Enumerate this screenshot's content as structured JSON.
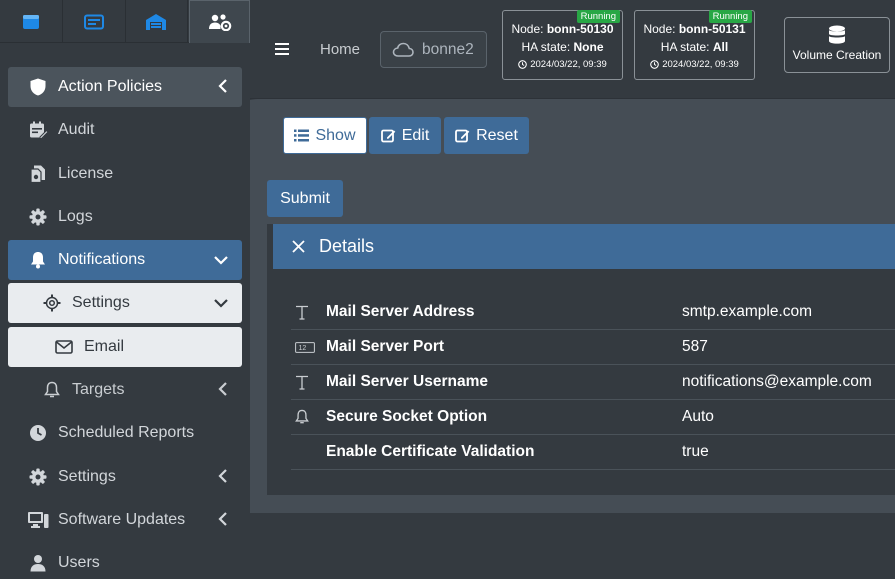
{
  "header": {
    "home_label": "Home",
    "cluster_name": "bonne2",
    "nodes": [
      {
        "node_prefix": "Node:",
        "name": "bonn-50130",
        "status": "Running",
        "ha_prefix": "HA state:",
        "ha_state": "None",
        "time": "2024/03/22, 09:39"
      },
      {
        "node_prefix": "Node:",
        "name": "bonn-50131",
        "status": "Running",
        "ha_prefix": "HA state:",
        "ha_state": "All",
        "time": "2024/03/22, 09:39"
      }
    ],
    "volume_creation_label": "Volume Creation"
  },
  "sidebar": {
    "items": [
      {
        "label": "Action Policies",
        "icon": "shield-icon"
      },
      {
        "label": "Audit",
        "icon": "calendar-edit-icon"
      },
      {
        "label": "License",
        "icon": "file-icon"
      },
      {
        "label": "Logs",
        "icon": "gear-icon"
      },
      {
        "label": "Notifications",
        "icon": "bell-icon"
      },
      {
        "label": "Settings",
        "icon": "gear-outline-icon"
      },
      {
        "label": "Email",
        "icon": "envelope-icon"
      },
      {
        "label": "Targets",
        "icon": "bell-outline-icon"
      },
      {
        "label": "Scheduled Reports",
        "icon": "clock-icon"
      },
      {
        "label": "Settings",
        "icon": "gear-icon"
      },
      {
        "label": "Software Updates",
        "icon": "desktop-icon"
      },
      {
        "label": "Users",
        "icon": "user-icon"
      }
    ]
  },
  "toolbar": {
    "show_label": "Show",
    "edit_label": "Edit",
    "reset_label": "Reset",
    "submit_label": "Submit"
  },
  "details": {
    "title": "Details",
    "rows": [
      {
        "label": "Mail Server Address",
        "value": "smtp.example.com",
        "icon": "text-icon"
      },
      {
        "label": "Mail Server Port",
        "value": "587",
        "icon": "number-icon"
      },
      {
        "label": "Mail Server Username",
        "value": "notifications@example.com",
        "icon": "text-icon"
      },
      {
        "label": "Secure Socket Option",
        "value": "Auto",
        "icon": "bell-outline-icon"
      },
      {
        "label": "Enable Certificate Validation",
        "value": "true",
        "icon": ""
      }
    ]
  },
  "colors": {
    "accent": "#3f6b98",
    "sidebar_bg": "#343a40",
    "content_bg": "#454d55",
    "running": "#28a745"
  }
}
